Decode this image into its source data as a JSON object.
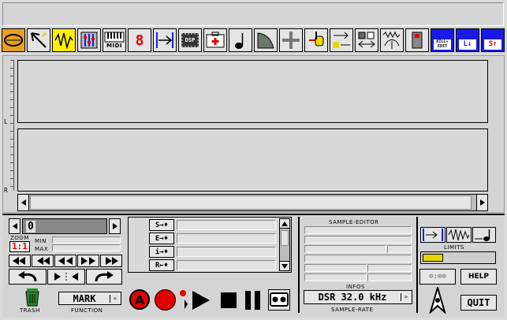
{
  "toolbar": {
    "icons": [
      "loop-icon",
      "cursor-icon",
      "waveform-select-icon",
      "mixer-icon",
      "midi-keyboard-icon",
      "digit-eight-icon",
      "split-icon",
      "dsp-chip-icon",
      "first-aid-icon",
      "note-icon",
      "curve-icon",
      "crosshair-icon",
      "hand-icon",
      "arrows-icon",
      "bars-icon",
      "wave-small-icon",
      "phone-icon",
      "kill-edit-disk-icon",
      "load-disk-icon",
      "save-disk-icon"
    ],
    "labels": {
      "midi": "MIDI",
      "dsp": "DSP",
      "kill": "KILL+ EDIT",
      "load": "L↓",
      "save": "S↑"
    }
  },
  "tracks": {
    "left_label": "L",
    "right_label": "R"
  },
  "zoom": {
    "counter": "0",
    "label": "ZOOM",
    "ratio": "1:1",
    "min": "MIN",
    "max": "MAX"
  },
  "marker_list": {
    "rows": [
      "S→♦",
      "E→♦",
      "i→♦",
      "R←♦"
    ]
  },
  "transport": {
    "record_label": "A"
  },
  "function": {
    "value": "MARK",
    "label": "FUNCTION",
    "trash": "TRASH"
  },
  "sample_editor": {
    "title": "SAMPLE-EDITOR",
    "infos": "INFOS",
    "rate_value": "DSR 32.0 kHz",
    "rate_label": "SAMPLE-RATE"
  },
  "right_panel": {
    "limits": "LIMITS",
    "clock": "⊙:⊙⊙",
    "help": "HELP",
    "quit": "QUIT"
  },
  "colors": {
    "red": "#e00000",
    "blue": "#1a1ae6",
    "yellow": "#ffee00"
  }
}
